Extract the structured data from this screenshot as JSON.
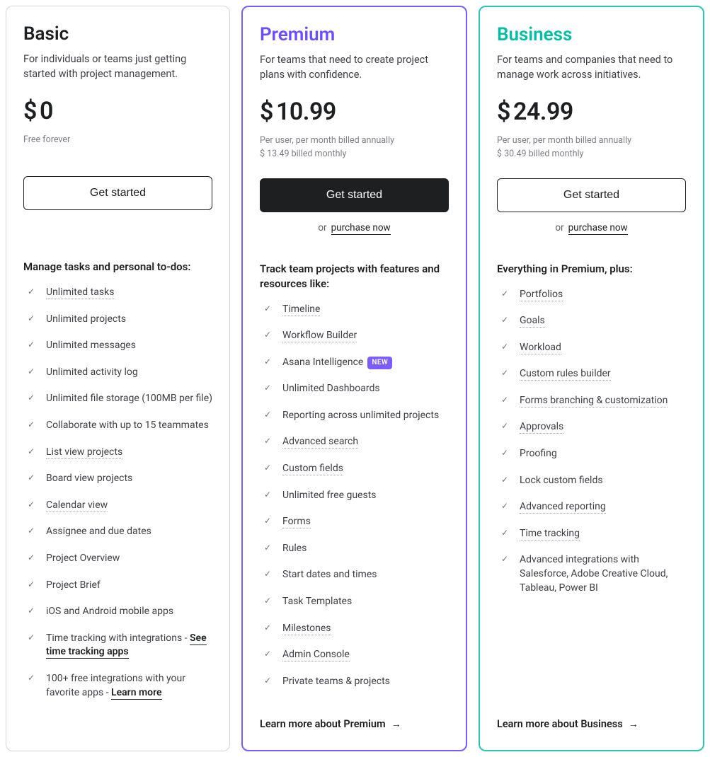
{
  "common": {
    "get_started": "Get started",
    "or": "or",
    "purchase_now": "purchase now",
    "new_badge": "NEW"
  },
  "plans": {
    "basic": {
      "name": "Basic",
      "desc": "For individuals or teams just getting started with project management.",
      "price": "0",
      "subprice1": "Free forever",
      "subprice2": "",
      "section_title": "Manage tasks and personal to-dos:",
      "features": [
        {
          "label": "Unlimited tasks",
          "dotted": true
        },
        {
          "label": "Unlimited projects"
        },
        {
          "label": "Unlimited messages"
        },
        {
          "label": "Unlimited activity log"
        },
        {
          "label": "Unlimited file storage (100MB per file)"
        },
        {
          "label": "Collaborate with up to 15 teammates"
        },
        {
          "label": "List view projects",
          "dotted": true
        },
        {
          "label": "Board view projects"
        },
        {
          "label": "Calendar view",
          "dotted": true
        },
        {
          "label": "Assignee and due dates"
        },
        {
          "label": "Project Overview"
        },
        {
          "label": "Project Brief"
        },
        {
          "label": "iOS and Android mobile apps"
        },
        {
          "label": "Time tracking with integrations - ",
          "trail_link": "See time tracking apps"
        },
        {
          "label": "100+ free integrations with your favorite apps - ",
          "trail_link": "Learn more"
        }
      ]
    },
    "premium": {
      "name": "Premium",
      "desc": "For teams that need to create project plans with confidence.",
      "price": "10.99",
      "subprice1": "Per user, per month billed annually",
      "subprice2": "$ 13.49 billed monthly",
      "section_title": "Track team projects with features and resources like:",
      "features": [
        {
          "label": "Timeline",
          "dotted": true
        },
        {
          "label": "Workflow Builder",
          "dotted": true
        },
        {
          "label": "Asana Intelligence",
          "new": true
        },
        {
          "label": "Unlimited Dashboards"
        },
        {
          "label": "Reporting across unlimited projects"
        },
        {
          "label": "Advanced search",
          "dotted": true
        },
        {
          "label": "Custom fields",
          "dotted": true
        },
        {
          "label": "Unlimited free guests"
        },
        {
          "label": "Forms",
          "dotted": true
        },
        {
          "label": "Rules"
        },
        {
          "label": "Start dates and times"
        },
        {
          "label": "Task Templates"
        },
        {
          "label": "Milestones",
          "dotted": true
        },
        {
          "label": "Admin Console",
          "dotted": true
        },
        {
          "label": "Private teams & projects"
        }
      ],
      "learn_more": "Learn more about Premium"
    },
    "business": {
      "name": "Business",
      "desc": "For teams and companies that need to manage work across initiatives.",
      "price": "24.99",
      "subprice1": "Per user, per month billed annually",
      "subprice2": "$ 30.49 billed monthly",
      "section_title": "Everything in Premium, plus:",
      "features": [
        {
          "label": "Portfolios",
          "dotted": true
        },
        {
          "label": "Goals",
          "dotted": true
        },
        {
          "label": "Workload",
          "dotted": true
        },
        {
          "label": "Custom rules builder",
          "dotted": true
        },
        {
          "label": "Forms branching & customization",
          "dotted": true
        },
        {
          "label": "Approvals",
          "dotted": true
        },
        {
          "label": "Proofing"
        },
        {
          "label": "Lock custom fields"
        },
        {
          "label": "Advanced reporting",
          "dotted": true
        },
        {
          "label": "Time tracking",
          "dotted": true
        },
        {
          "label": "Advanced integrations with Salesforce, Adobe Creative Cloud, Tableau, Power BI"
        }
      ],
      "learn_more": "Learn more about Business"
    }
  }
}
